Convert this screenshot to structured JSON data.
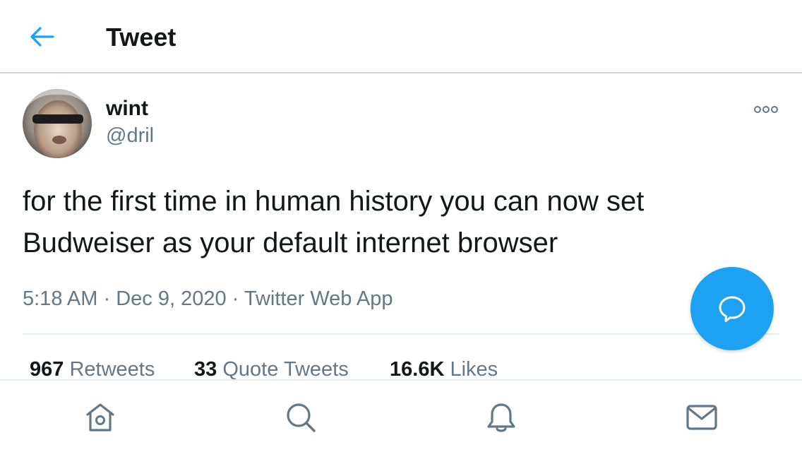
{
  "header": {
    "title": "Tweet",
    "back_icon": "arrow-left-icon",
    "accent_color": "#1da1f2"
  },
  "author": {
    "display_name": "wint",
    "handle": "@dril",
    "avatar_icon": "profile-photo"
  },
  "tweet": {
    "text": "for the first time in human history you can now set Budweiser as your default internet browser",
    "time": "5:18 AM",
    "separator": "·",
    "date": "Dec 9, 2020",
    "source": "Twitter Web App"
  },
  "stats": [
    {
      "count": "967",
      "label": "Retweets"
    },
    {
      "count": "33",
      "label": "Quote Tweets"
    },
    {
      "count": "16.6K",
      "label": "Likes"
    }
  ],
  "fab": {
    "icon": "reply-bubble-icon"
  },
  "tabbar": [
    {
      "name": "home",
      "icon": "home-icon"
    },
    {
      "name": "search",
      "icon": "search-icon"
    },
    {
      "name": "notifications",
      "icon": "bell-icon"
    },
    {
      "name": "messages",
      "icon": "envelope-icon"
    }
  ]
}
